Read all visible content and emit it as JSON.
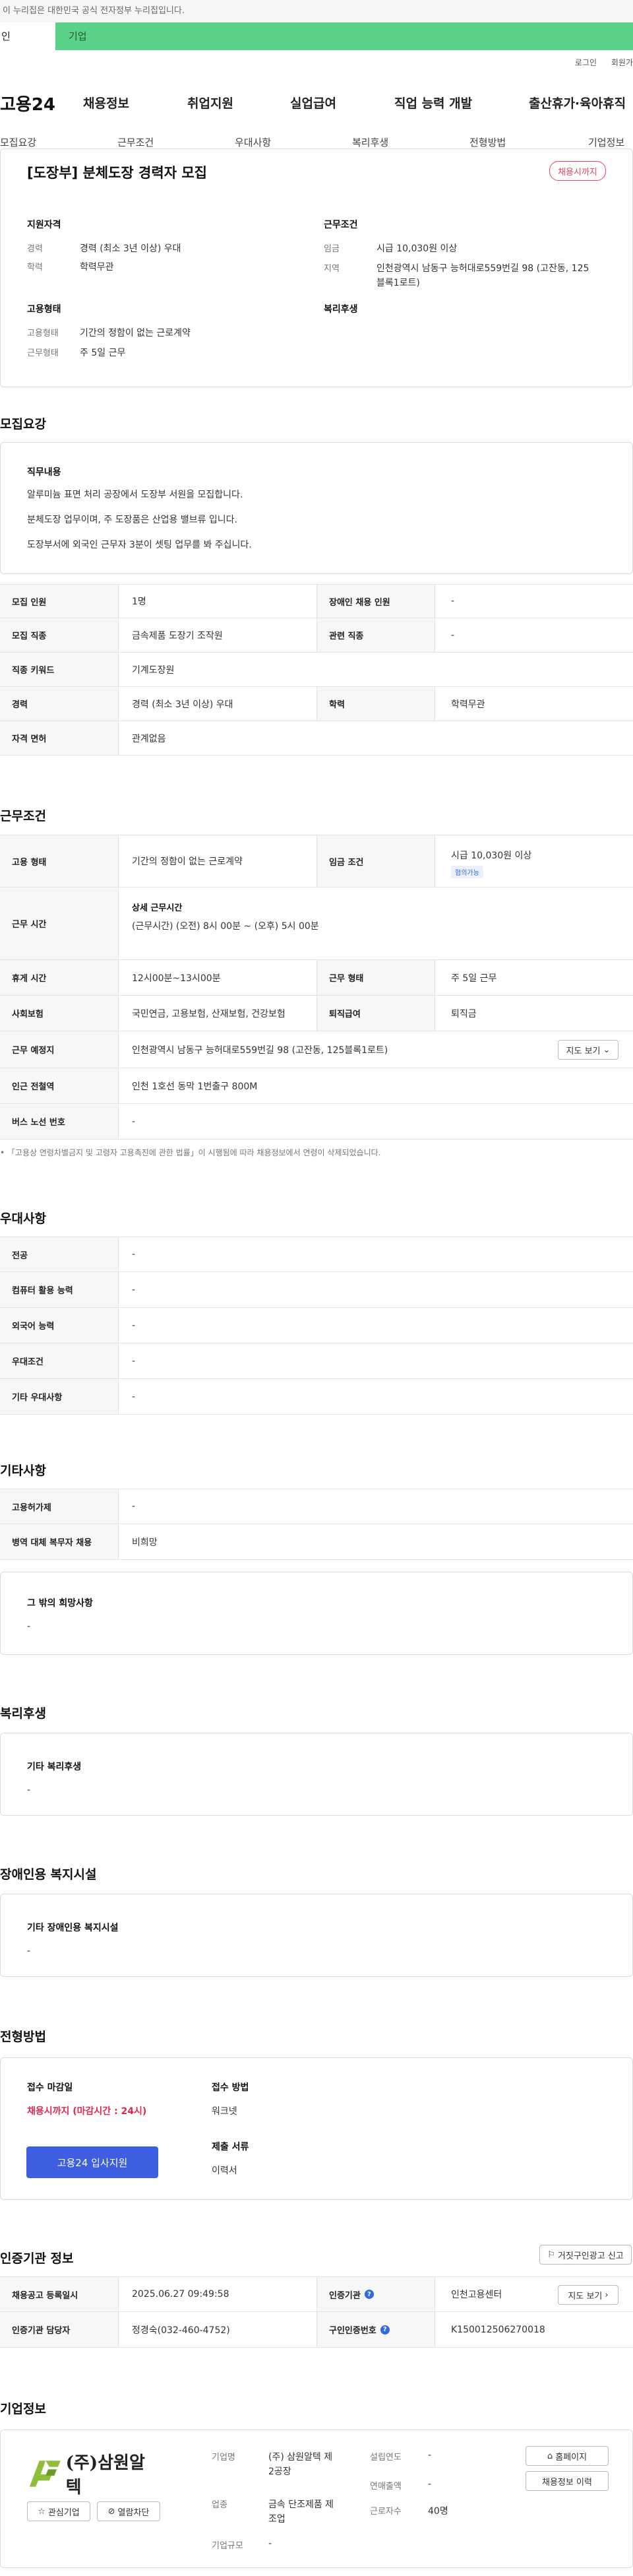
{
  "gov_notice": "이 누리집은 대한민국 공식 전자정부 누리집입니다.",
  "persona_tabs": [
    "인",
    "기업"
  ],
  "util_links": [
    "로그인",
    "회원가"
  ],
  "logo": "고용24",
  "gnb": [
    "채용정보",
    "취업지원",
    "실업급여",
    "직업 능력 개발",
    "출산휴가·육아휴직"
  ],
  "tabs": [
    "모집요강",
    "근무조건",
    "우대사항",
    "복리후생",
    "전형방법",
    "기업정보"
  ],
  "summary": {
    "title": "[도장부] 분체도장 경력자 모집",
    "badge": "채용시까지",
    "qual_head": "지원자격",
    "qual": [
      {
        "k": "경력",
        "v": "경력 (최소 3년 이상) 우대"
      },
      {
        "k": "학력",
        "v": "학력무관"
      }
    ],
    "emp_head": "고용형태",
    "emp": [
      {
        "k": "고용형태",
        "v": "기간의 정함이 없는 근로계약"
      },
      {
        "k": "근무형태",
        "v": "주 5일 근무"
      }
    ],
    "cond_head": "근무조건",
    "cond": [
      {
        "k": "임금",
        "v": "시급 10,030원 이상"
      },
      {
        "k": "지역",
        "v": "인천광역시 남동구 능허대로559번길 98 (고잔동, 125"
      },
      {
        "k": "",
        "v": "블록1로트)"
      }
    ],
    "welfare_head": "복리후생"
  },
  "recruit": {
    "heading": "모집요강",
    "duty_head": "직무내용",
    "duty_lines": [
      "알루미늄 표면 처리 공장에서 도장부 서원을 모집합니다.",
      "분체도장 업무이며, 주 도장품은 산업용 밸브류 입니다.",
      "도장부서에 외국인 근무자 3분이 셋팅 업무를 봐 주십니다."
    ],
    "rows": [
      {
        "k1": "모집 인원",
        "v1": "1명",
        "k2": "장애인 채용 인원",
        "v2": "-"
      },
      {
        "k1": "모집 직종",
        "v1": "금속제품 도장기 조작원",
        "k2": "관련 직종",
        "v2": "-"
      },
      {
        "k1": "직종 키워드",
        "v1": "기계도장원"
      },
      {
        "k1": "경력",
        "v1": "경력 (최소 3년 이상) 우대",
        "k2": "학력",
        "v2": "학력무관"
      },
      {
        "k1": "자격 면허",
        "v1": "관계없음"
      }
    ]
  },
  "work": {
    "heading": "근무조건",
    "type_k": "고용 형태",
    "type_v": "기간의 정함이 없는 근로계약",
    "wage_k": "임금 조건",
    "wage_v": "시급 10,030원 이상",
    "wage_tag": "협의가능",
    "hours_k": "근무 시간",
    "hours_sub": "상세 근무시간",
    "hours_v": "(근무시간) (오전) 8시 00분 ~ (오후) 5시 00분",
    "break_k": "휴게 시간",
    "break_v": "12시00분~13시00분",
    "form_k": "근무 형태",
    "form_v": "주 5일 근무",
    "ins_k": "사회보험",
    "ins_v": "국민연금, 고용보험, 산재보험, 건강보험",
    "sev_k": "퇴직급여",
    "sev_v": "퇴직금",
    "place_k": "근무 예정지",
    "place_v": "인천광역시 남동구 능허대로559번길 98 (고잔동, 125블록1로트)",
    "map_btn": "지도 보기",
    "subway_k": "인근 전철역",
    "subway_v": "인천 1호선 동막 1번출구 800M",
    "bus_k": "버스 노선 번호",
    "bus_v": "-",
    "note": "「고용상 연령차별금지 및 고령자 고용촉진에 관한 법률」이 시행됨에 따라 채용정보에서 연령이 삭제되었습니다."
  },
  "pref": {
    "heading": "우대사항",
    "rows": [
      {
        "k": "전공",
        "v": "-"
      },
      {
        "k": "컴퓨터 활용 능력",
        "v": "-"
      },
      {
        "k": "외국어 능력",
        "v": "-"
      },
      {
        "k": "우대조건",
        "v": "-"
      },
      {
        "k": "기타 우대사항",
        "v": "-"
      }
    ]
  },
  "etc": {
    "heading": "기타사항",
    "rows": [
      {
        "k": "고용허가제",
        "v": "-"
      },
      {
        "k": "병역 대체 복무자 채용",
        "v": "비희망"
      }
    ],
    "box_title": "그 밖의 희망사항",
    "box_v": "-"
  },
  "welfare": {
    "heading": "복리후생",
    "box_title": "기타 복리후생",
    "box_v": "-"
  },
  "disab": {
    "heading": "장애인용 복지시설",
    "box_title": "기타 장애인용 복지시설",
    "box_v": "-"
  },
  "selection": {
    "heading": "전형방법",
    "deadline_k": "접수 마감일",
    "deadline_v": "채용시까지 (마감시간 : 24시)",
    "apply_btn": "고용24 입사지원",
    "method_k": "접수 방법",
    "method_v": "워크넷",
    "docs_k": "제출 서류",
    "docs_v": "이력서"
  },
  "agency": {
    "heading": "인증기관 정보",
    "report_btn": "거짓구인광고 신고",
    "reg_k": "채용공고 등록일시",
    "reg_v": "2025.06.27 09:49:58",
    "org_k": "인증기관",
    "org_v": "인천고용센터",
    "map_btn": "지도 보기",
    "mgr_k": "인증기관 담당자",
    "mgr_v": "정경숙(032-460-4752)",
    "num_k": "구인인증번호",
    "num_v": "K150012506270018"
  },
  "company": {
    "heading": "기업정보",
    "logo_text": "(주)삼원알텍",
    "fav_btn": "관심기업",
    "block_btn": "열람차단",
    "name_k": "기업명",
    "name_v1": "(주) 삼원알텍 제",
    "name_v2": "2공장",
    "ind_k": "업종",
    "ind_v1": "금속 단조제품 제",
    "ind_v2": "조업",
    "size_k": "기업규모",
    "size_v": "-",
    "est_k": "설립연도",
    "est_v": "-",
    "sales_k": "연매출액",
    "sales_v": "-",
    "emp_k": "근로자수",
    "emp_v": "40명",
    "home_btn": "홈페이지",
    "hist_btn": "채용정보 이력"
  }
}
